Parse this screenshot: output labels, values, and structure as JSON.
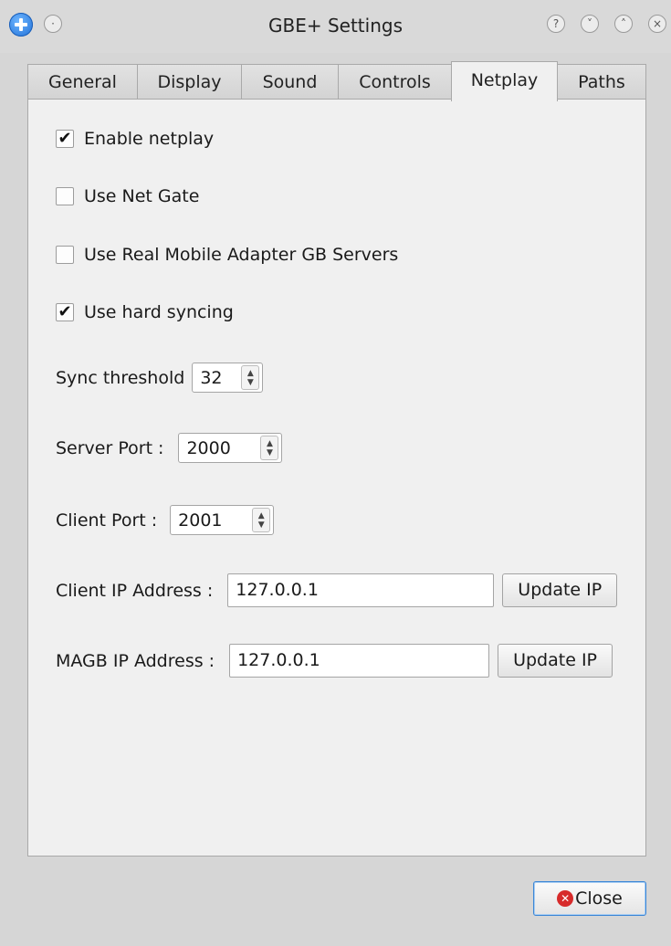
{
  "window": {
    "title": "GBE+ Settings",
    "title_buttons": [
      "?",
      "˅",
      "˄",
      "×"
    ]
  },
  "tabs": [
    {
      "label": "General",
      "active": false
    },
    {
      "label": "Display",
      "active": false
    },
    {
      "label": "Sound",
      "active": false
    },
    {
      "label": "Controls",
      "active": false
    },
    {
      "label": "Netplay",
      "active": true
    },
    {
      "label": "Paths",
      "active": false
    }
  ],
  "netplay": {
    "enable_netplay": {
      "label": "Enable netplay",
      "checked": true,
      "mark": "✔"
    },
    "use_net_gate": {
      "label": "Use Net Gate",
      "checked": false,
      "mark": ""
    },
    "use_real_magb": {
      "label": "Use Real Mobile Adapter GB Servers",
      "checked": false,
      "mark": ""
    },
    "hard_sync": {
      "label": "Use hard syncing",
      "checked": true,
      "mark": "✔"
    },
    "sync_threshold": {
      "label": "Sync threshold",
      "value": "32"
    },
    "server_port": {
      "label": "Server Port :",
      "value": "2000"
    },
    "client_port": {
      "label": "Client Port :",
      "value": "2001"
    },
    "client_ip": {
      "label": "Client IP Address :",
      "value": "127.0.0.1",
      "button": "Update IP"
    },
    "magb_ip": {
      "label": "MAGB IP Address :",
      "value": "127.0.0.1",
      "button": "Update IP"
    }
  },
  "footer": {
    "close_label": "Close"
  },
  "colors": {
    "accent": "#3b86d6",
    "close_icon": "#d72b2b",
    "app_icon": "#1f6fd6"
  }
}
